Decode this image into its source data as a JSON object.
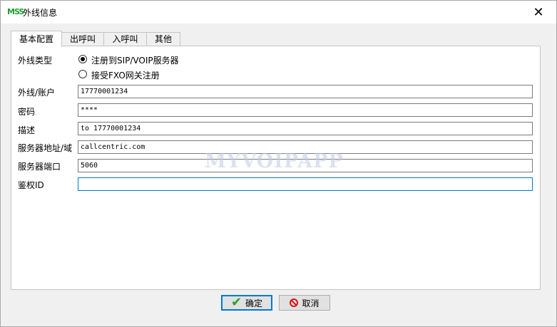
{
  "window": {
    "title": "外线信息",
    "app_icon": "MSS"
  },
  "tabs": [
    {
      "label": "基本配置",
      "active": true
    },
    {
      "label": "出呼叫",
      "active": false
    },
    {
      "label": "入呼叫",
      "active": false
    },
    {
      "label": "其他",
      "active": false
    }
  ],
  "form": {
    "line_type_label": "外线类型",
    "radio_sip": "注册到SIP/VOIP服务器",
    "radio_fxo": "接受FXO网关注册",
    "selected": "sip",
    "account_label": "外线/账户",
    "account_value": "17770001234",
    "password_label": "密码",
    "password_value": "****",
    "description_label": "描述",
    "description_value": "to 17770001234",
    "server_label": "服务器地址/域",
    "server_value": "callcentric.com",
    "port_label": "服务器端口",
    "port_value": "5060",
    "auth_label": "鉴权ID",
    "auth_value": ""
  },
  "watermark": "MYVOIPAPP",
  "buttons": {
    "ok": "确定",
    "cancel": "取消"
  },
  "colors": {
    "focus": "#0078d7",
    "ok_icon": "#2aa02a",
    "cancel_icon": "#dd1111"
  }
}
